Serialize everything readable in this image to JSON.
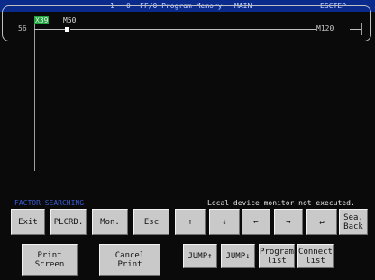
{
  "titlebar": {
    "seg1": "1",
    "seg2": "0",
    "seg3": "FF/0 Program Memory",
    "seg4": "MAIN",
    "seg5": "ESCTEP"
  },
  "ladder": {
    "step": "56",
    "contact1": "X39",
    "contact2": "M50",
    "coil": "M120"
  },
  "status": {
    "left": "FACTOR SEARCHING",
    "right": "Local device monitor not executed."
  },
  "buttons_row1": [
    "Exit",
    "PLCRD.",
    "Mon.",
    "Esc",
    "↑",
    "↓",
    "←",
    "→",
    "↵",
    "Sea.\nBack"
  ],
  "buttons_row2": [
    "Print\nScreen",
    "Cancel\nPrint",
    "JUMP↑",
    "JUMP↓",
    "Program\nlist",
    "Connect\nlist"
  ]
}
